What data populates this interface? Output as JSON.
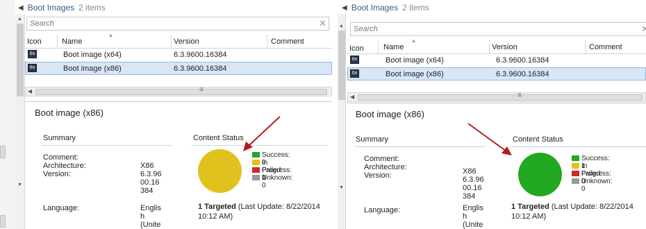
{
  "colors": {
    "success": "#22a822",
    "in_progress": "#e0c21e",
    "failed": "#cc2a2a",
    "unknown": "#999999",
    "selection": "#d9e6f7",
    "arrow": "#b51d1d"
  },
  "left": {
    "header": {
      "title": "Boot Images",
      "count": "2 items"
    },
    "search": {
      "placeholder": "Search"
    },
    "columns": {
      "icon": "Icon",
      "name": "Name",
      "version": "Version",
      "comment": "Comment"
    },
    "rows": [
      {
        "icon": "boot-image-icon",
        "name": "Boot image (x64)",
        "version": "6.3.9600.16384",
        "comment": ""
      },
      {
        "icon": "boot-image-icon",
        "name": "Boot image (x86)",
        "version": "6.3.9600.16384",
        "comment": ""
      }
    ],
    "detail": {
      "title": "Boot image (x86)",
      "summary_label": "Summary",
      "content_status_label": "Content Status",
      "fields": {
        "comment_label": "Comment:",
        "architecture_label": "Architecture:",
        "architecture_value": "X86",
        "version_label": "Version:",
        "version_lines": [
          "6.3.96",
          "00.16",
          "384"
        ],
        "language_label": "Language:",
        "language_lines": [
          "Englis",
          "h",
          "(Unite"
        ]
      },
      "legend": {
        "success": "Success: 0",
        "in_progress": "In Progress: 1",
        "failed": "Failed: 0",
        "unknown": "Unknown: 0"
      },
      "status": {
        "success": 0,
        "in_progress": 1,
        "failed": 0,
        "unknown": 0
      },
      "targeted_bold": "1 Targeted",
      "targeted_rest": " (Last Update: 8/22/2014",
      "targeted_time": "10:12 AM)"
    }
  },
  "right": {
    "header": {
      "title": "Boot Images",
      "count": "2 items"
    },
    "search": {
      "placeholder": "Search"
    },
    "columns": {
      "icon": "Icon",
      "name": "Name",
      "version": "Version",
      "comment": "Comment"
    },
    "rows": [
      {
        "icon": "boot-image-icon",
        "name": "Boot image (x64)",
        "version": "6.3.9600.16384",
        "comment": ""
      },
      {
        "icon": "boot-image-icon",
        "name": "Boot image (x86)",
        "version": "6.3.9600.16384",
        "comment": ""
      }
    ],
    "detail": {
      "title": "Boot image (x86)",
      "summary_label": "Summary",
      "content_status_label": "Content Status",
      "fields": {
        "comment_label": "Comment:",
        "architecture_label": "Architecture:",
        "architecture_value": "X86",
        "version_label": "Version:",
        "version_lines": [
          "6.3.96",
          "00.16",
          "384"
        ],
        "language_label": "Language:",
        "language_lines": [
          "Englis",
          "h",
          "(Unite"
        ]
      },
      "legend": {
        "success": "Success: 1",
        "in_progress": "In Progress: 0",
        "failed": "Failed: 0",
        "unknown": "Unknown: 0"
      },
      "status": {
        "success": 1,
        "in_progress": 0,
        "failed": 0,
        "unknown": 0
      },
      "targeted_bold": "1 Targeted",
      "targeted_rest": " (Last Update: 8/22/2014",
      "targeted_time": "10:12 AM)"
    }
  }
}
